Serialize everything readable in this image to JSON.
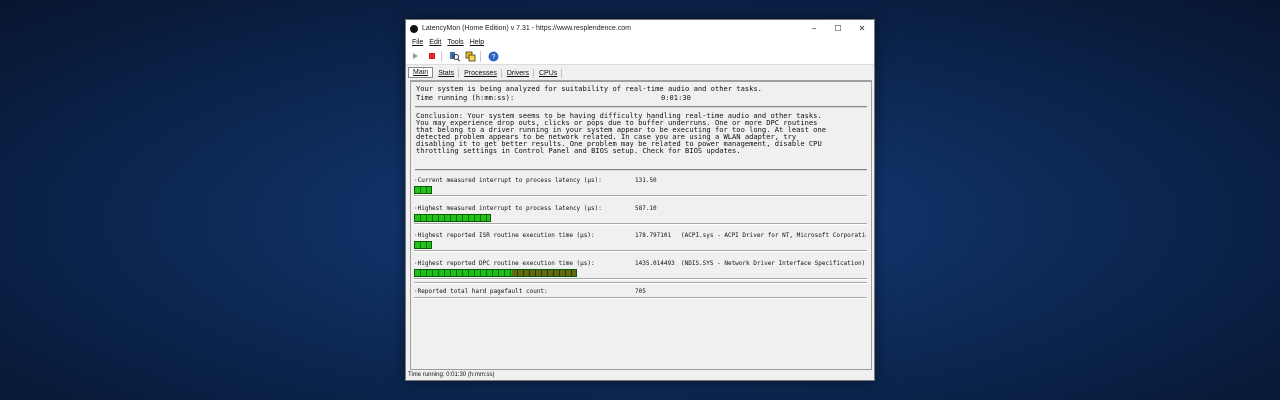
{
  "window": {
    "title": "LatencyMon  (Home Edition)  v 7.31 - https://www.resplendence.com",
    "controls": {
      "minimize": "–",
      "maximize": "☐",
      "close": "✕"
    }
  },
  "menu": [
    "File",
    "Edit",
    "Tools",
    "Help"
  ],
  "toolbar": {
    "icons": [
      "play-icon",
      "stop-icon",
      "search-icon",
      "copy-icon",
      "help-icon"
    ]
  },
  "tabs": [
    "Main",
    "Stats",
    "Processes",
    "Drivers",
    "CPUs"
  ],
  "analysis": {
    "line1": "Your system is being analyzed for suitability of real-time audio and other tasks.",
    "time_label": "Time running (h:mm:ss):",
    "time_value": "0:01:30"
  },
  "conclusion": [
    "Conclusion: Your system seems to be having difficulty handling real-time audio and other tasks.",
    "You may experience drop outs, clicks or pops due to buffer underruns. One or more DPC routines",
    "that belong to a driver running in your system appear to be executing for too long. At least one",
    "detected problem appears to be network related. In case you are using a WLAN adapter, try",
    "disabling it to get better results. One problem may be related to power management, disable CPU",
    "throttling settings in Control Panel and BIOS setup. Check for BIOS updates."
  ],
  "metrics": [
    {
      "label": "·Current measured interrupt to process latency (µs):",
      "value": "131.50",
      "extra": "",
      "level": 0.04,
      "warn": false
    },
    {
      "label": "·Highest measured interrupt to process latency (µs):",
      "value": "587.10",
      "extra": "",
      "level": 0.17,
      "warn": false
    },
    {
      "label": "·Highest reported ISR routine execution time (µs):",
      "value": "178.797101",
      "extra": "(ACPI.sys - ACPI Driver for NT, Microsoft Corporation)",
      "level": 0.04,
      "warn": false
    },
    {
      "label": "·Highest reported DPC routine execution time (µs):",
      "value": "1435.014493",
      "extra": "(NDIS.SYS - Network Driver Interface Specification)",
      "level": 0.36,
      "warn": true
    },
    {
      "label": "·Reported total hard pagefault count:",
      "value": "705",
      "extra": "",
      "level": null,
      "warn": false
    }
  ],
  "statusbar": "Time running: 0:01:30  (h:mm:ss)"
}
